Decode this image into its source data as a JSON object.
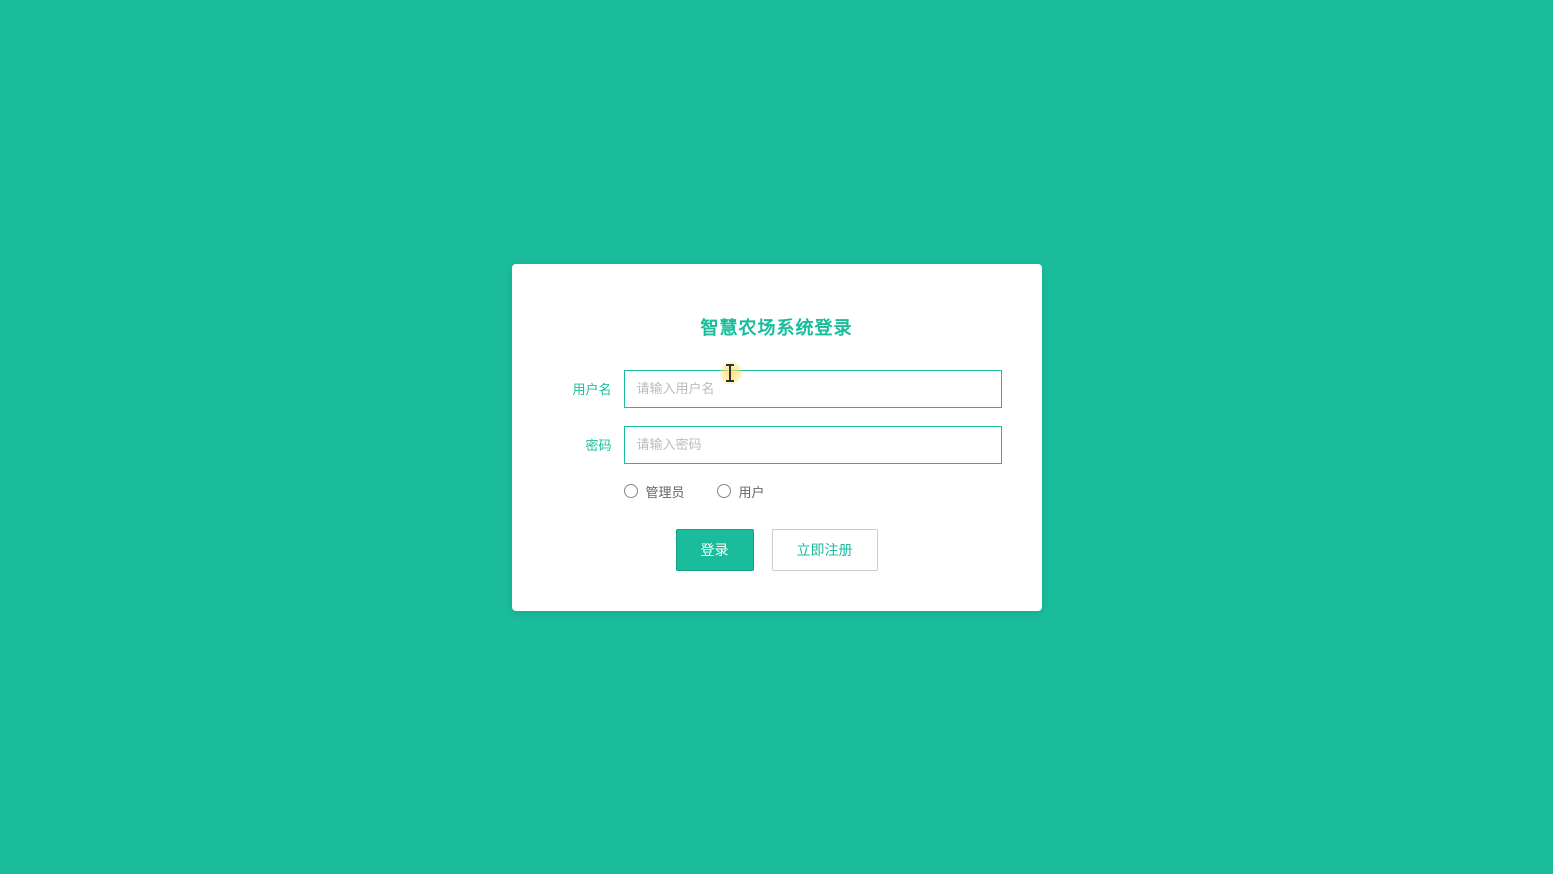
{
  "title": "智慧农场系统登录",
  "form": {
    "username": {
      "label": "用户名",
      "placeholder": "请输入用户名",
      "value": ""
    },
    "password": {
      "label": "密码",
      "placeholder": "请输入密码",
      "value": ""
    }
  },
  "roles": {
    "admin": "管理员",
    "user": "用户"
  },
  "buttons": {
    "login": "登录",
    "register": "立即注册"
  }
}
